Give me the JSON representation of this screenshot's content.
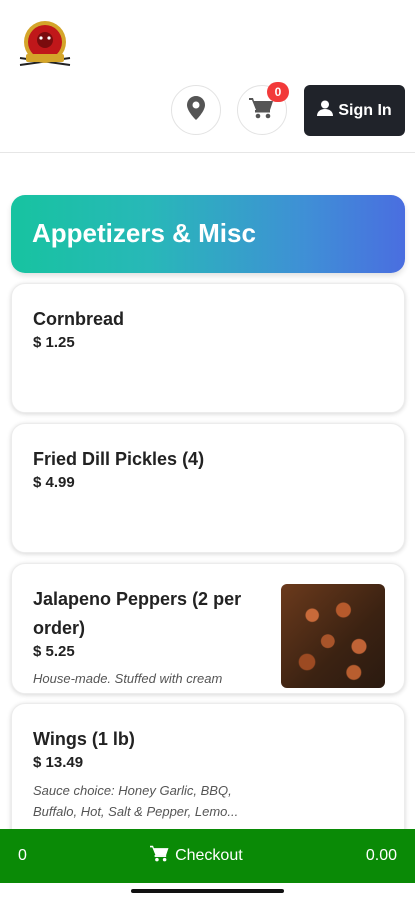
{
  "header": {
    "logo_icon": "restaurant-logo",
    "location_icon": "map-pin-icon",
    "cart_icon": "cart-icon",
    "cart_count": "0",
    "signin_label": "Sign In",
    "signin_icon": "user-icon"
  },
  "category": {
    "title": "Appetizers & Misc"
  },
  "items": [
    {
      "name": "Cornbread",
      "price": "$ 1.25"
    },
    {
      "name": "Fried Dill Pickles (4)",
      "price": "$ 4.99"
    },
    {
      "name_line1": "Jalapeno Peppers (2 per",
      "name_line2": "order)",
      "price": "$ 5.25",
      "description": "House-made. Stuffed with cream"
    },
    {
      "name": "Wings (1 lb)",
      "price": "$ 13.49",
      "desc_line1": "Sauce choice: Honey Garlic, BBQ,",
      "desc_line2": "Buffalo, Hot, Salt & Pepper, Lemo..."
    }
  ],
  "bottom_bar": {
    "count": "0",
    "checkout_label": "Checkout",
    "checkout_icon": "cart-icon",
    "total": "0.00"
  },
  "colors": {
    "accent_green": "#0a8a06",
    "badge_red": "#f23a3a",
    "signin_dark": "#20232a",
    "gradient_start": "#17c3a0",
    "gradient_end": "#4a6ee0"
  }
}
